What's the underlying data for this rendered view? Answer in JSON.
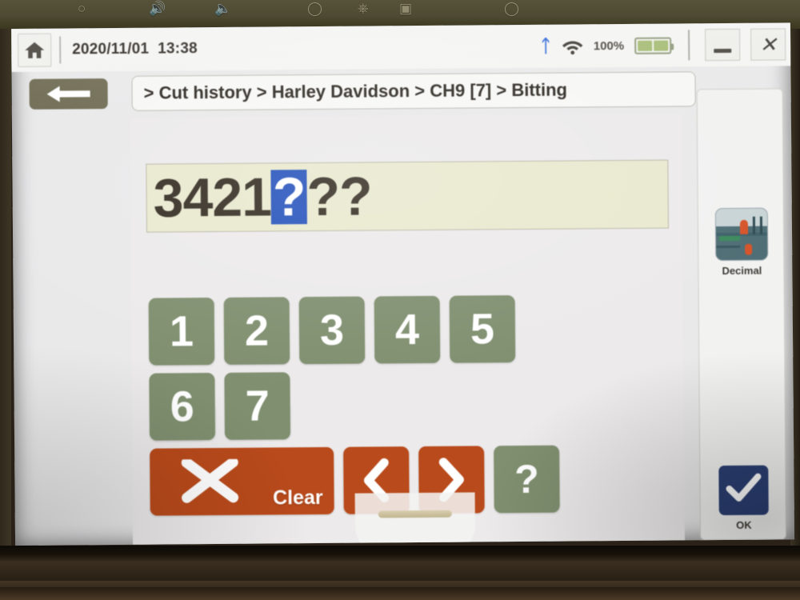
{
  "device": {
    "bezel_icons": [
      "power-icon",
      "volume-up-icon",
      "volume-down-icon",
      "usb-icon",
      "camera-icon",
      "lens-icon",
      "mic-icon"
    ]
  },
  "status_bar": {
    "home_icon": "home-icon",
    "datetime": "2020/11/01  13:38",
    "bluetooth_icon": "bluetooth-icon",
    "wifi_icon": "wifi-icon",
    "battery_percent": "100%",
    "battery_icon": "battery-full-icon",
    "minimize_label": "minimize-icon",
    "close_label": "✕"
  },
  "nav": {
    "back_icon": "back-arrow-icon",
    "breadcrumb": "> Cut history > Harley Davidson > CH9 [7] > Bitting"
  },
  "display": {
    "entered": "3421",
    "cursor_char": "?",
    "remaining": "??",
    "full_value": "3421???",
    "bg_color": "#e9e9cf",
    "cursor_bg_color": "#2452bb"
  },
  "keypad": {
    "rows": [
      [
        {
          "label": "1",
          "name": "key-1",
          "style": "green"
        },
        {
          "label": "2",
          "name": "key-2",
          "style": "green"
        },
        {
          "label": "3",
          "name": "key-3",
          "style": "green"
        },
        {
          "label": "4",
          "name": "key-4",
          "style": "green"
        },
        {
          "label": "5",
          "name": "key-5",
          "style": "green"
        }
      ],
      [
        {
          "label": "6",
          "name": "key-6",
          "style": "green"
        },
        {
          "label": "7",
          "name": "key-7",
          "style": "green"
        }
      ]
    ],
    "clear": {
      "label": "Clear",
      "icon": "x-icon",
      "name": "clear-button"
    },
    "prev": {
      "icon": "chevron-left-icon",
      "name": "previous-position-button"
    },
    "next": {
      "icon": "chevron-right-icon",
      "name": "next-position-button"
    },
    "unknown": {
      "label": "?",
      "name": "unknown-value-button"
    },
    "green_color": "#7f8f6f",
    "orange_color": "#b94a1b"
  },
  "sidebar": {
    "items": [
      {
        "label": "Decimal",
        "name": "sidebar-decimal-button",
        "icon": "decimal-thumbnail-icon"
      },
      {
        "label": "OK",
        "name": "sidebar-ok-button",
        "icon": "check-icon"
      }
    ],
    "ok_color": "#2b3f73"
  },
  "stand": {
    "handle": "stand-handle"
  }
}
